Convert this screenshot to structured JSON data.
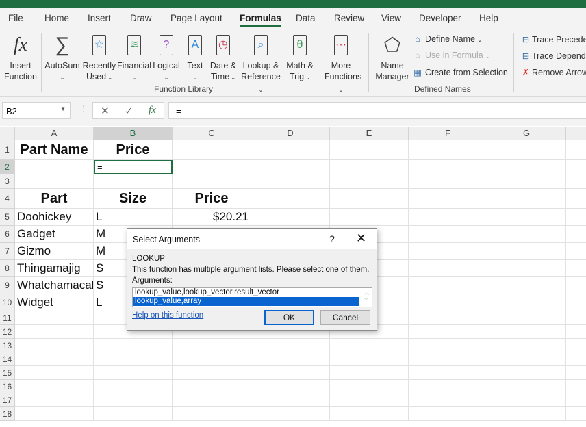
{
  "ribbon_tabs": [
    "File",
    "Home",
    "Insert",
    "Draw",
    "Page Layout",
    "Formulas",
    "Data",
    "Review",
    "View",
    "Developer",
    "Help"
  ],
  "active_tab": "Formulas",
  "function_library": {
    "insert_function": [
      "Insert",
      "Function"
    ],
    "buttons": [
      {
        "l1": "AutoSum",
        "l2": "",
        "icon": "sigma-icon",
        "glyph": "∑",
        "color": "#444"
      },
      {
        "l1": "Recently",
        "l2": "Used",
        "icon": "star-book-icon",
        "glyph": "☆",
        "color": "#2b88d8"
      },
      {
        "l1": "Financial",
        "l2": "",
        "icon": "coins-book-icon",
        "glyph": "≋",
        "color": "#3a9a5a"
      },
      {
        "l1": "Logical",
        "l2": "",
        "icon": "question-book-icon",
        "glyph": "?",
        "color": "#9b4fc9"
      },
      {
        "l1": "Text",
        "l2": "",
        "icon": "text-book-icon",
        "glyph": "A",
        "color": "#2b88d8"
      },
      {
        "l1": "Date &",
        "l2": "Time",
        "icon": "clock-book-icon",
        "glyph": "◷",
        "color": "#c8304a"
      },
      {
        "l1": "Lookup &",
        "l2": "Reference",
        "icon": "magnifier-book-icon",
        "glyph": "⌕",
        "color": "#2b88d8"
      },
      {
        "l1": "Math &",
        "l2": "Trig",
        "icon": "theta-book-icon",
        "glyph": "θ",
        "color": "#3a9a5a"
      },
      {
        "l1": "More",
        "l2": "Functions",
        "icon": "more-book-icon",
        "glyph": "···",
        "color": "#c8304a"
      }
    ],
    "group_label": "Function Library"
  },
  "defined_names": {
    "name_manager": [
      "Name",
      "Manager"
    ],
    "define_name": "Define Name",
    "use_in_formula": "Use in Formula",
    "create_from_selection": "Create from Selection",
    "group_label": "Defined Names"
  },
  "formula_auditing": {
    "trace_precedents": "Trace Preceden",
    "trace_dependents": "Trace Depende",
    "remove_arrows": "Remove Arrow"
  },
  "formula_bar": {
    "name_box": "B2",
    "formula": "="
  },
  "columns": [
    "A",
    "B",
    "C",
    "D",
    "E",
    "F",
    "G"
  ],
  "selected_column": "B",
  "selected_row": 2,
  "rows": [
    {
      "n": 1,
      "cells": [
        "Part Name",
        "Price",
        ""
      ],
      "header": true
    },
    {
      "n": 2,
      "cells": [
        "",
        "=",
        ""
      ]
    },
    {
      "n": 3,
      "cells": [
        "",
        "",
        ""
      ]
    },
    {
      "n": 4,
      "cells": [
        "Part",
        "Size",
        "Price"
      ],
      "header": true
    },
    {
      "n": 5,
      "cells": [
        "Doohickey",
        "L",
        "$20.21"
      ]
    },
    {
      "n": 6,
      "cells": [
        "Gadget",
        "M",
        ""
      ]
    },
    {
      "n": 7,
      "cells": [
        "Gizmo",
        "M",
        ""
      ]
    },
    {
      "n": 8,
      "cells": [
        "Thingamajig",
        "S",
        ""
      ]
    },
    {
      "n": 9,
      "cells": [
        "Whatchamacallit",
        "S",
        ""
      ]
    },
    {
      "n": 10,
      "cells": [
        "Widget",
        "L",
        ""
      ]
    },
    {
      "n": 11,
      "cells": [
        "",
        "",
        ""
      ]
    },
    {
      "n": 12,
      "cells": [
        "",
        "",
        ""
      ]
    },
    {
      "n": 13,
      "cells": [
        "",
        "",
        ""
      ]
    },
    {
      "n": 14,
      "cells": [
        "",
        "",
        ""
      ]
    },
    {
      "n": 15,
      "cells": [
        "",
        "",
        ""
      ]
    },
    {
      "n": 16,
      "cells": [
        "",
        "",
        ""
      ]
    },
    {
      "n": 17,
      "cells": [
        "",
        "",
        ""
      ]
    },
    {
      "n": 18,
      "cells": [
        "",
        "",
        ""
      ]
    }
  ],
  "dialog": {
    "title": "Select Arguments",
    "help": "?",
    "close": "✕",
    "function_name": "LOOKUP",
    "message": "This function has multiple argument lists.  Please select one of them.",
    "arguments_label": "Arguments:",
    "options": [
      "lookup_value,lookup_vector,result_vector",
      "lookup_value,array"
    ],
    "selected_option": 1,
    "help_link": "Help on this function",
    "ok": "OK",
    "cancel": "Cancel"
  },
  "colors": {
    "accent": "#1e6e41",
    "selection": "#0a64d0"
  }
}
